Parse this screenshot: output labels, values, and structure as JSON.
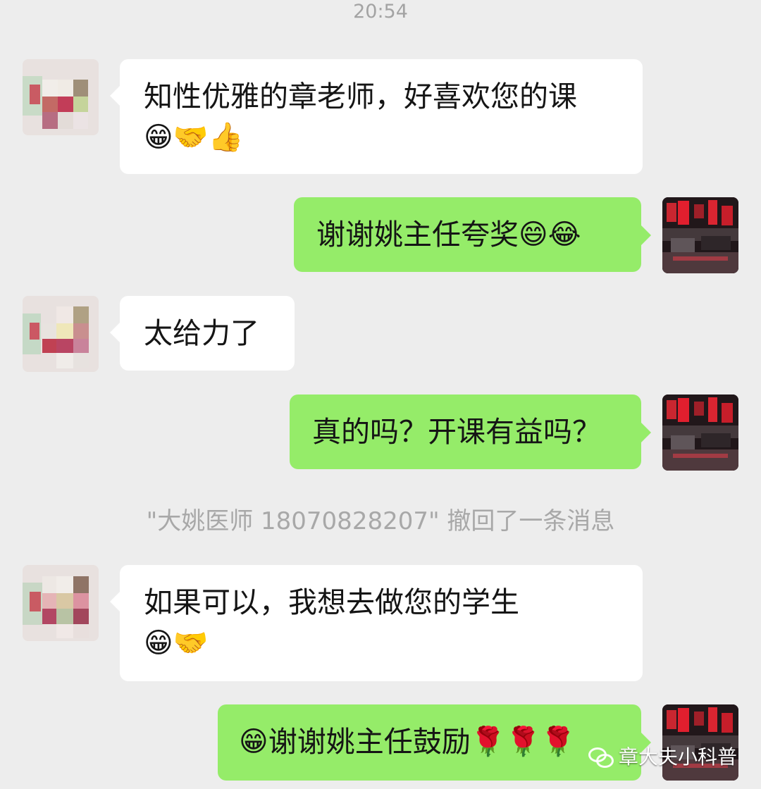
{
  "chat": {
    "time": "20:54",
    "recall_notice": "\"大姚医师 18070828207\" 撤回了一条消息",
    "messages": [
      {
        "side": "left",
        "text": "知性优雅的章老师，好喜欢您的课",
        "emoji": "😁🤝👍"
      },
      {
        "side": "right",
        "text": "谢谢姚主任夸奖",
        "emoji": "😄😂"
      },
      {
        "side": "left",
        "text": "太给力了",
        "emoji": ""
      },
      {
        "side": "right",
        "text": "真的吗？开课有益吗？",
        "emoji": ""
      },
      {
        "side": "left",
        "text": "如果可以，我想去做您的学生",
        "emoji": "😁🤝"
      },
      {
        "side": "right",
        "text": "谢谢姚主任鼓励",
        "emoji_before": "😁",
        "emoji_after": "🌹🌹🌹"
      }
    ]
  },
  "watermark": {
    "text": "章大夫小科普"
  },
  "colors": {
    "background": "#ededed",
    "incoming_bubble": "#ffffff",
    "outgoing_bubble": "#95ec69",
    "meta_text": "#a3a3a3"
  }
}
